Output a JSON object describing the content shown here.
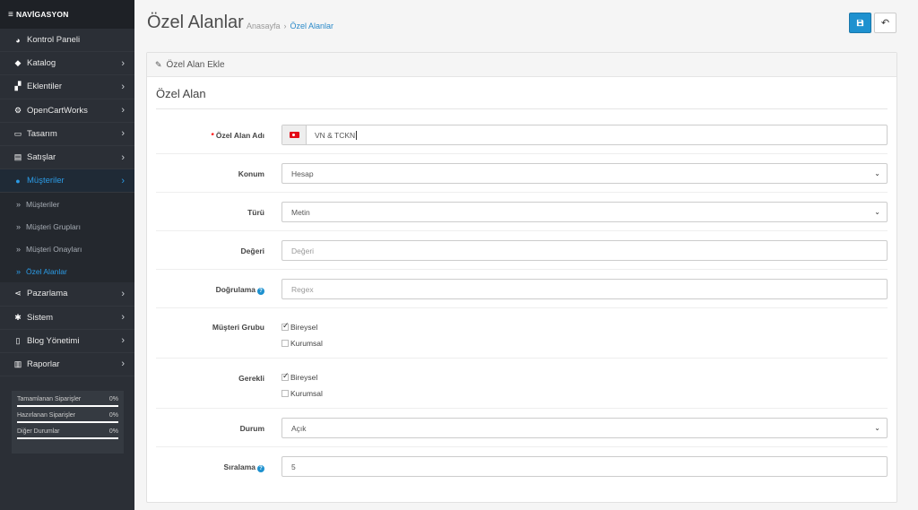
{
  "sidebar": {
    "heading": "NAVİGASYON",
    "items": [
      {
        "label": "Kontrol Paneli",
        "icon": "dashboard-icon",
        "chevron": false
      },
      {
        "label": "Katalog",
        "icon": "tags-icon",
        "chevron": true
      },
      {
        "label": "Eklentiler",
        "icon": "puzzle-icon",
        "chevron": true
      },
      {
        "label": "OpenCartWorks",
        "icon": "cogs-icon",
        "chevron": true
      },
      {
        "label": "Tasarım",
        "icon": "monitor-icon",
        "chevron": true
      },
      {
        "label": "Satışlar",
        "icon": "cart-icon",
        "chevron": true
      },
      {
        "label": "Müşteriler",
        "icon": "user-icon",
        "chevron": true,
        "active": true
      }
    ],
    "submenu": [
      {
        "label": "Müşteriler"
      },
      {
        "label": "Müşteri Grupları"
      },
      {
        "label": "Müşteri Onayları"
      },
      {
        "label": "Özel Alanlar",
        "active": true
      }
    ],
    "items_after": [
      {
        "label": "Pazarlama",
        "icon": "share-icon"
      },
      {
        "label": "Sistem",
        "icon": "gear-icon"
      },
      {
        "label": "Blog Yönetimi",
        "icon": "book-icon"
      },
      {
        "label": "Raporlar",
        "icon": "bar-chart-icon"
      }
    ],
    "stats": [
      {
        "label": "Tamamlanan Siparişler",
        "value": "0%"
      },
      {
        "label": "Hazırlanan Siparişler",
        "value": "0%"
      },
      {
        "label": "Diğer Durumlar",
        "value": "0%"
      }
    ]
  },
  "header": {
    "title": "Özel Alanlar",
    "breadcrumb_home": "Anasayfa",
    "breadcrumb_sep": "›",
    "breadcrumb_current": "Özel Alanlar"
  },
  "panel": {
    "heading": "Özel Alan Ekle",
    "legend": "Özel Alan",
    "fields": {
      "name_label": "Özel Alan Adı",
      "name_value": "VN & TCKN",
      "location_label": "Konum",
      "location_value": "Hesap",
      "type_label": "Türü",
      "type_value": "Metin",
      "value_label": "Değeri",
      "value_placeholder": "Değeri",
      "validation_label": "Doğrulama",
      "validation_placeholder": "Regex",
      "group_label": "Müşteri Grubu",
      "group_options": [
        {
          "label": "Bireysel",
          "checked": true
        },
        {
          "label": "Kurumsal",
          "checked": false
        }
      ],
      "required_label": "Gerekli",
      "required_options": [
        {
          "label": "Bireysel",
          "checked": true
        },
        {
          "label": "Kurumsal",
          "checked": false
        }
      ],
      "status_label": "Durum",
      "status_value": "Açık",
      "sort_label": "Sıralama",
      "sort_value": "5"
    }
  },
  "colors": {
    "accent": "#1e91cf",
    "sidebar_bg": "#2b2f36",
    "active_link": "#2b9be6"
  }
}
